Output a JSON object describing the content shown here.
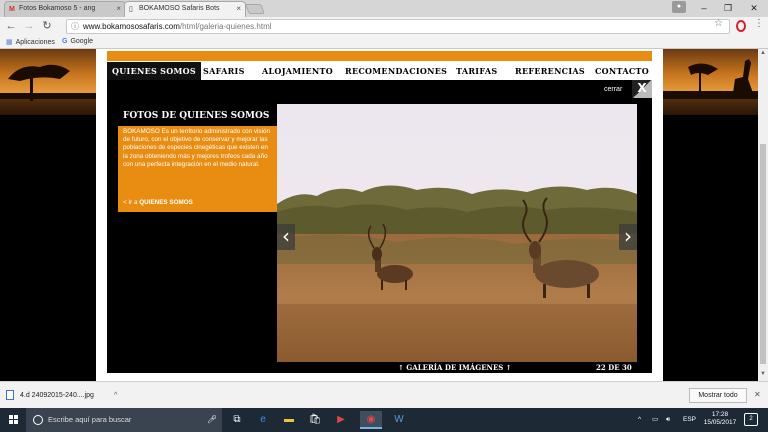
{
  "browser": {
    "tabs": [
      {
        "label": "Fotos Bokamoso 5 - ang",
        "favicon": "gmail-icon"
      },
      {
        "label": "BOKAMOSO Safaris Bots",
        "favicon": "page-icon"
      }
    ],
    "address": {
      "host": "www.bokamososafaris.com",
      "path": "/html/galeria-quienes.html"
    },
    "bookmarks": [
      {
        "label": "Aplicaciones",
        "icon": "apps-grid-icon"
      },
      {
        "label": "Google",
        "icon": "google-g-icon"
      }
    ]
  },
  "site": {
    "menu": [
      "QUIENES SOMOS",
      "SAFARIS",
      "ALOJAMIENTO",
      "RECOMENDACIONES",
      "TARIFAS",
      "REFERENCIAS",
      "CONTACTO"
    ],
    "close_label": "cerrar",
    "close_x": "X",
    "info": {
      "title": "FOTOS DE QUIENES SOMOS",
      "text": "BOKAMOSO Es un territorio administrado con visión de futuro, con el objetivo de conservar y mejorar las poblaciones de especies cinegéticas que existen en la zona obteniendo más y mejores trofeos cada año con una perfecta integración en el medio natural.",
      "link_prefix": "< Ir a",
      "link_bold": "QUIENES SOMOS"
    },
    "gallery": {
      "label": "↑ GALERÍA DE IMÁGENES ↑",
      "counter": "22 DE 30"
    },
    "colors": {
      "accent": "#e88d12",
      "panel": "#000000"
    }
  },
  "downloads": {
    "file": "4.d  24092015-240....jpg",
    "show_all": "Mostrar todo"
  },
  "taskbar": {
    "search_placeholder": "Escribe aquí para buscar",
    "lang": "ESP",
    "time": "17:28",
    "date": "15/05/2017",
    "notifications": "2"
  }
}
